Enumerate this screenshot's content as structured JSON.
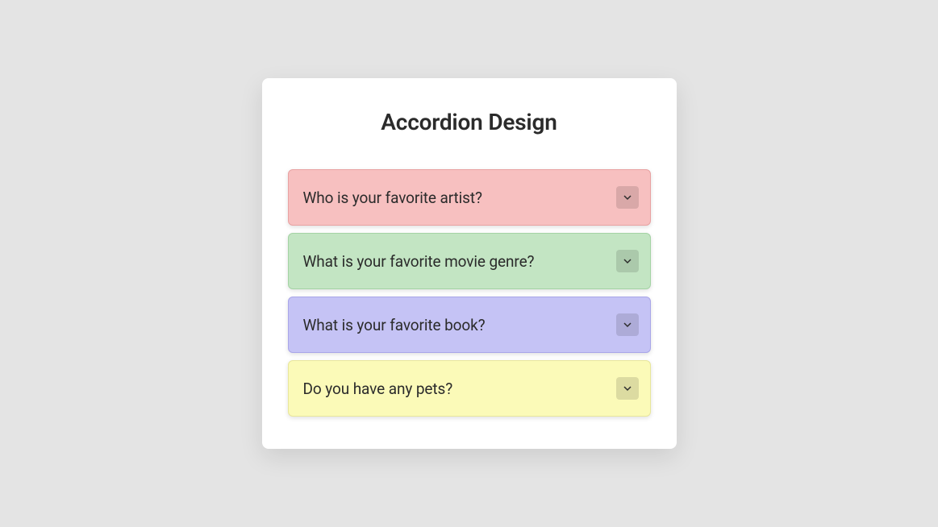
{
  "title": "Accordion Design",
  "items": [
    {
      "label": "Who is your favorite artist?"
    },
    {
      "label": "What is your favorite movie genre?"
    },
    {
      "label": "What is your favorite book?"
    },
    {
      "label": "Do you have any pets?"
    }
  ]
}
